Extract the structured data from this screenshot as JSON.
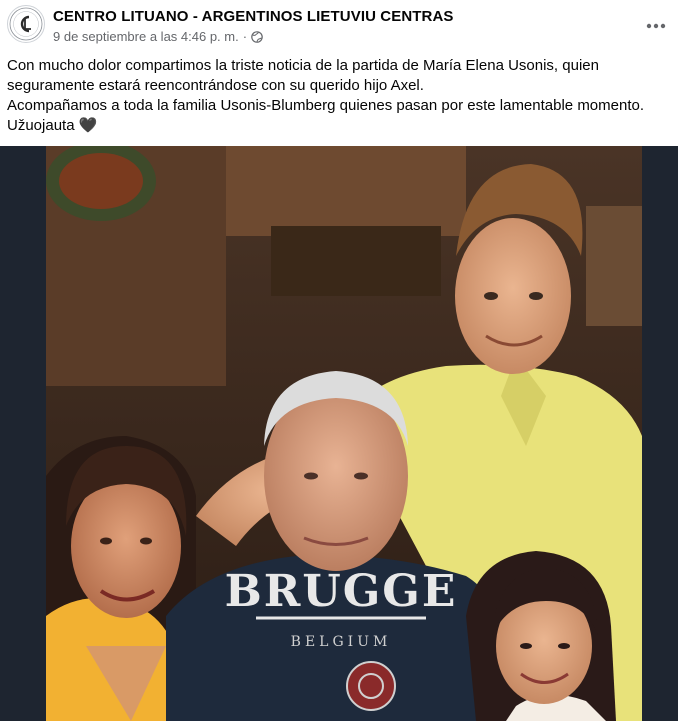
{
  "post": {
    "page_name": "CENTRO LITUANO - ARGENTINOS LIETUVIU CENTRAS",
    "timestamp": "9 de septiembre a las 4:46 p. m.",
    "separator": "·",
    "privacy_icon": "globe-icon",
    "more_icon": "more-horizontal-icon",
    "caption_lines": [
      "Con mucho dolor compartimos la triste noticia de la partida de María Elena Usonis, quien seguramente estará reencontrándose con su querido hijo Axel.",
      "Acompañamos a toda la familia Usonis-Blumberg quienes pasan por este lamentable momento.",
      "Užuojauta 🖤"
    ]
  },
  "photo": {
    "shirt_text": "BRUGGE",
    "shirt_subtext": "BELGIUM"
  },
  "colors": {
    "text_primary": "#050505",
    "text_secondary": "#65676b",
    "photo_frame": "#1e2530"
  }
}
